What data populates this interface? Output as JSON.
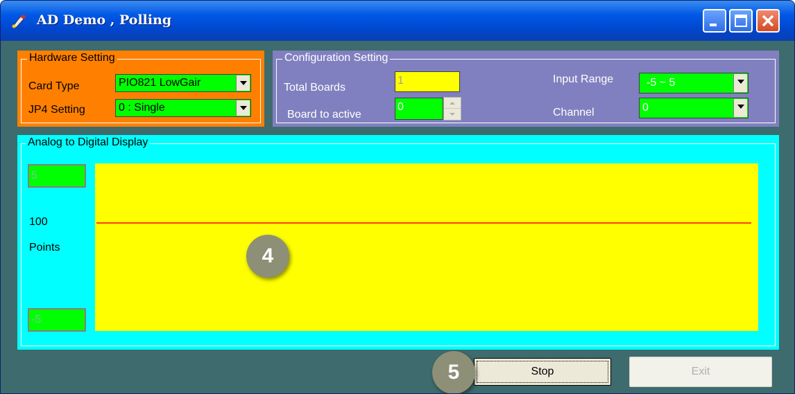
{
  "window": {
    "title": "AD Demo , Polling"
  },
  "hardware_setting": {
    "legend": "Hardware Setting",
    "card_type_label": "Card Type",
    "card_type_value": "PIO821 LowGair",
    "jp4_label": "JP4 Setting",
    "jp4_value": "0 : Single"
  },
  "configuration_setting": {
    "legend": "Configuration Setting",
    "total_boards_label": "Total Boards",
    "total_boards_value": "1",
    "board_to_active_label": "Board to active",
    "board_to_active_value": "0",
    "input_range_label": "Input Range",
    "input_range_value": "-5 ~ 5",
    "channel_label": "Channel",
    "channel_value": "0"
  },
  "display": {
    "legend": "Analog to Digital Display",
    "y_max": "5",
    "y_min": "-5",
    "points_count": "100",
    "points_label": "Points"
  },
  "buttons": {
    "stop": "Stop",
    "exit": "Exit"
  },
  "callouts": {
    "plot_marker": "4",
    "stop_marker": "5"
  },
  "colors": {
    "hardware_group": "#ff8000",
    "config_group": "#8080c0",
    "display_group": "#00ffff",
    "field_green": "#00ff00",
    "plot_background": "#ffff00",
    "signal_line": "#ff0000",
    "client_background": "#3e6b6d"
  }
}
